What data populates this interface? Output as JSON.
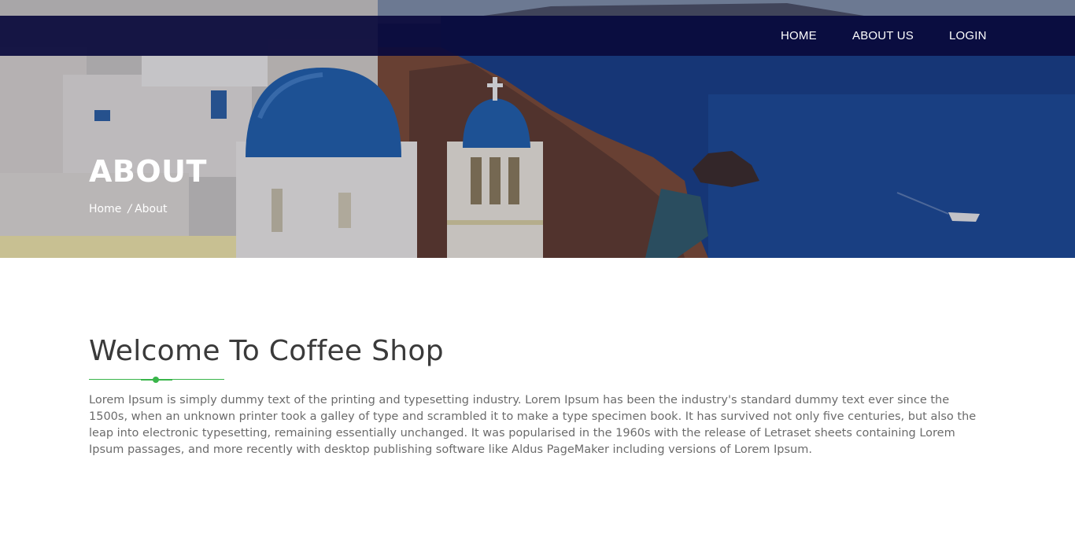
{
  "nav": {
    "items": [
      {
        "label": "HOME"
      },
      {
        "label": "ABOUT US"
      },
      {
        "label": "LOGIN"
      }
    ]
  },
  "hero": {
    "title": "ABOUT",
    "breadcrumb": {
      "home": "Home",
      "separator": "/",
      "current": "About"
    }
  },
  "content": {
    "heading": "Welcome To Coffee Shop",
    "paragraph": "Lorem Ipsum is simply dummy text of the printing and typesetting industry. Lorem Ipsum has been the industry's standard dummy text ever since the 1500s, when an unknown printer took a galley of type and scrambled it to make a type specimen book. It has survived not only five centuries, but also the leap into electronic typesetting, remaining essentially unchanged. It was popularised in the 1960s with the release of Letraset sheets containing Lorem Ipsum passages, and more recently with desktop publishing software like Aldus PageMaker including versions of Lorem Ipsum."
  },
  "colors": {
    "navbar": "#0a0a3c",
    "accent": "#39b54a",
    "heading": "#3a3a3a",
    "body_text": "#6b6b6b"
  }
}
